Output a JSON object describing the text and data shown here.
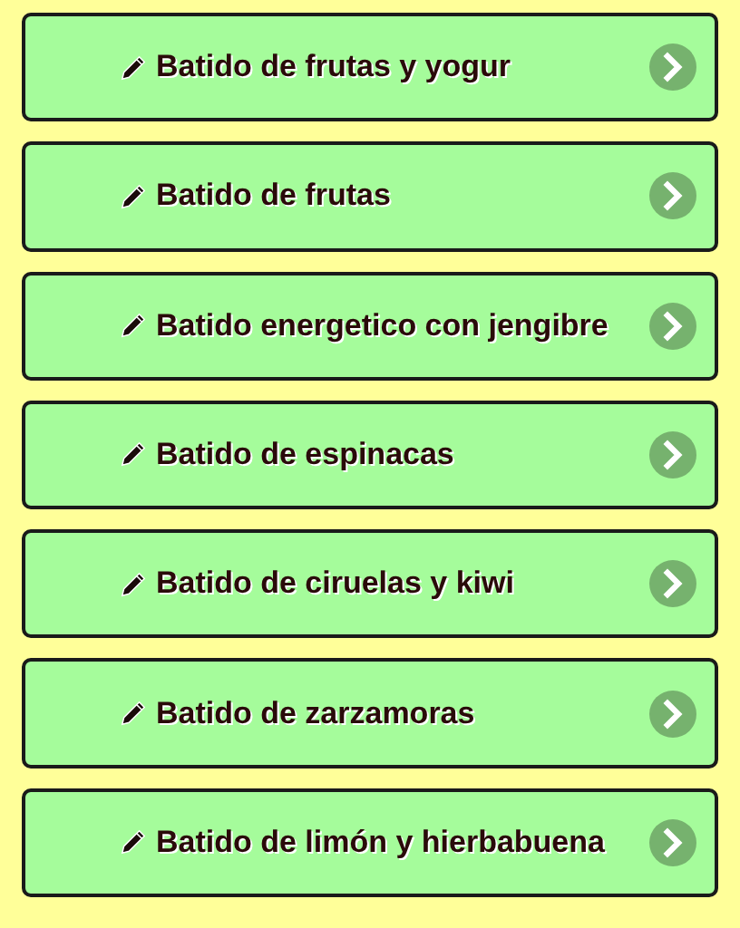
{
  "items": [
    {
      "label": "Batido de frutas y yogur"
    },
    {
      "label": "Batido de frutas"
    },
    {
      "label": "Batido energetico con jengibre"
    },
    {
      "label": "Batido de espinacas"
    },
    {
      "label": "Batido de ciruelas y kiwi"
    },
    {
      "label": "Batido de zarzamoras"
    },
    {
      "label": "Batido de limón y hierbabuena"
    }
  ]
}
